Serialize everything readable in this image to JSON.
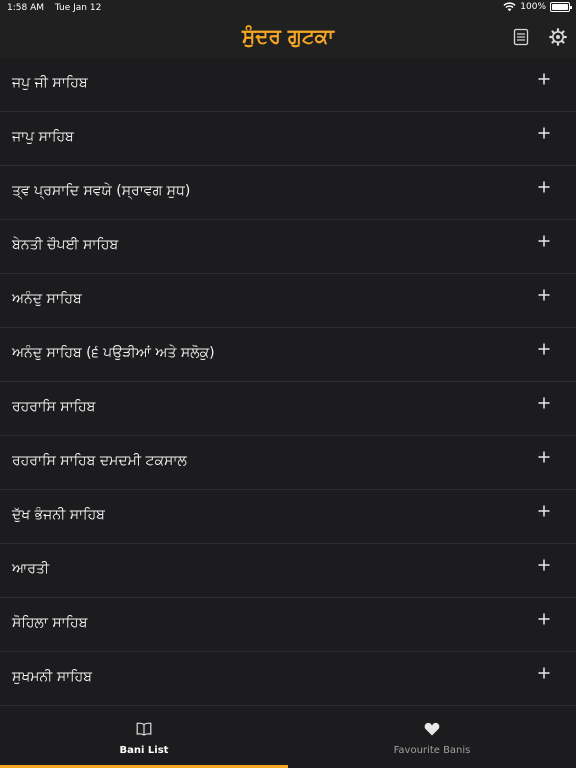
{
  "status_bar": {
    "time": "1:58 AM",
    "date": "Tue Jan 12",
    "battery": "100%"
  },
  "header": {
    "title": "ਸੁੰਦਰ ਗੁਟਕਾ",
    "title_color": "#f5a623",
    "icons": [
      "reader-icon",
      "gear-icon"
    ]
  },
  "bani_list": {
    "items": [
      {
        "label": "ਜਪੁ ਜੀ ਸਾਹਿਬ",
        "action_icon": "plus-icon"
      },
      {
        "label": "ਜਾਪੁ ਸਾਹਿਬ",
        "action_icon": "plus-icon"
      },
      {
        "label": "ਤ੍ਵ ਪ੍ਰਸਾਦਿ ਸਵਯੇ (ਸ੍ਰਾਵਗ ਸੁਧ)",
        "action_icon": "plus-icon"
      },
      {
        "label": "ਬੇਨਤੀ ਚੌਪਈ ਸਾਹਿਬ",
        "action_icon": "plus-icon"
      },
      {
        "label": "ਅਨੰਦੁ ਸਾਹਿਬ",
        "action_icon": "plus-icon"
      },
      {
        "label": "ਅਨੰਦੁ ਸਾਹਿਬ (੬ ਪਉੜੀਆਂ ਅਤੇ ਸਲੋਕੁ)",
        "action_icon": "plus-icon"
      },
      {
        "label": "ਰਹਰਾਸਿ ਸਾਹਿਬ",
        "action_icon": "plus-icon"
      },
      {
        "label": "ਰਹਰਾਸਿ ਸਾਹਿਬ ਦਮਦਮੀ ਟਕਸਾਲ",
        "action_icon": "plus-icon"
      },
      {
        "label": "ਦੁੱਖ ਭੰਜਨੀ ਸਾਹਿਬ",
        "action_icon": "plus-icon"
      },
      {
        "label": "ਆਰਤੀ",
        "action_icon": "plus-icon"
      },
      {
        "label": "ਸੋਹਿਲਾ ਸਾਹਿਬ",
        "action_icon": "plus-icon"
      },
      {
        "label": "ਸੁਖਮਨੀ ਸਾਹਿਬ",
        "action_icon": "plus-icon"
      }
    ]
  },
  "tab_bar": {
    "tabs": [
      {
        "label": "Bani List",
        "icon": "book-icon",
        "selected": true
      },
      {
        "label": "Favourite Banis",
        "icon": "heart-icon",
        "selected": false
      }
    ],
    "accent_color": "#f5a623"
  }
}
